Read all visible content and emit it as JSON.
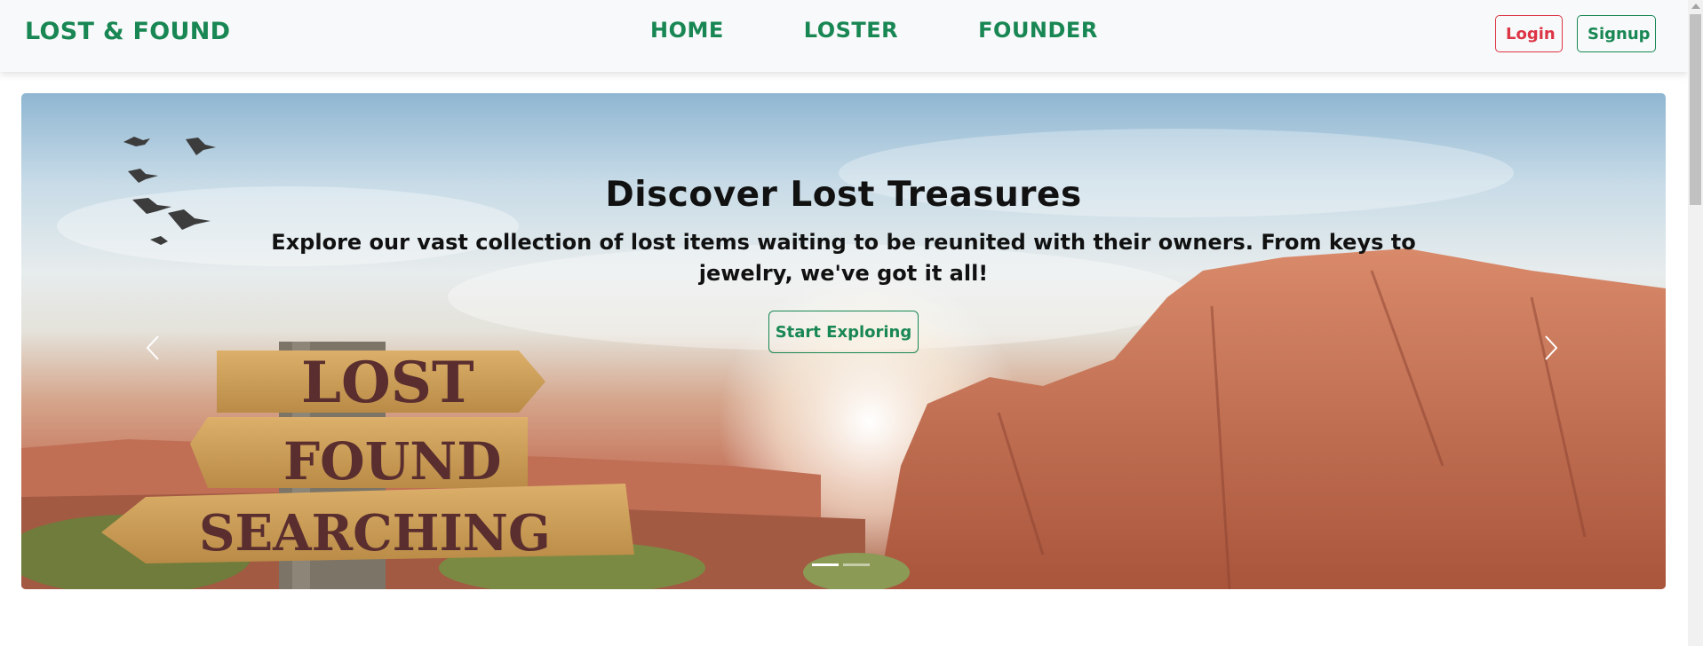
{
  "navbar": {
    "brand": "LOST & FOUND",
    "links": [
      "HOME",
      "LOSTER",
      "FOUNDER"
    ],
    "login_label": "Login",
    "signup_label": "Signup",
    "colors": {
      "brand": "#198754",
      "danger": "#dc3545",
      "background": "#f8f9fa"
    }
  },
  "carousel": {
    "heading": "Discover Lost Treasures",
    "description": "Explore our vast collection of lost items waiting to be reunited with their owners. From keys to jewelry, we've got it all!",
    "button_label": "Start Exploring",
    "sign_words": [
      "LOST",
      "FOUND",
      "SEARCHING"
    ],
    "prev_icon": "chevron-left-icon",
    "next_icon": "chevron-right-icon",
    "slides": 2,
    "active_slide": 1
  }
}
